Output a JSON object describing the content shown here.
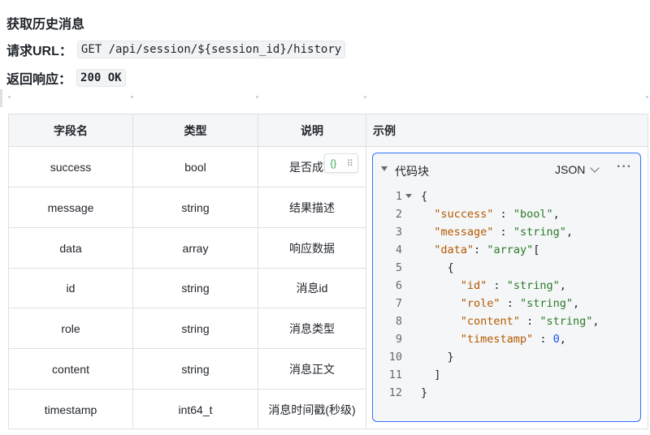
{
  "title": "获取历史消息",
  "request": {
    "label": "请求URL：",
    "value": "GET /api/session/${session_id}/history"
  },
  "response": {
    "label": "返回响应：",
    "value": "200 OK"
  },
  "table": {
    "headers": [
      "字段名",
      "类型",
      "说明",
      "示例"
    ],
    "rows": [
      {
        "field": "success",
        "type": "bool",
        "desc": "是否成功"
      },
      {
        "field": "message",
        "type": "string",
        "desc": "结果描述"
      },
      {
        "field": "data",
        "type": "array",
        "desc": "响应数据"
      },
      {
        "field": "id",
        "type": "string",
        "desc": "消息id"
      },
      {
        "field": "role",
        "type": "string",
        "desc": "消息类型"
      },
      {
        "field": "content",
        "type": "string",
        "desc": "消息正文"
      },
      {
        "field": "timestamp",
        "type": "int64_t",
        "desc": "消息时间戳(秒级)"
      }
    ]
  },
  "float_tool": {
    "icon": "{}",
    "grip": "⠿"
  },
  "codeblock": {
    "title": "代码块",
    "language": "JSON",
    "more": "···",
    "lines": [
      {
        "n": "1",
        "fold": true,
        "indent": "",
        "parts": [
          [
            "p",
            "{"
          ]
        ]
      },
      {
        "n": "2",
        "fold": false,
        "indent": "  ",
        "parts": [
          [
            "k",
            "\"success\""
          ],
          [
            "p",
            " : "
          ],
          [
            "s",
            "\"bool\""
          ],
          [
            "p",
            ","
          ]
        ]
      },
      {
        "n": "3",
        "fold": false,
        "indent": "  ",
        "parts": [
          [
            "k",
            "\"message\""
          ],
          [
            "p",
            " : "
          ],
          [
            "s",
            "\"string\""
          ],
          [
            "p",
            ","
          ]
        ]
      },
      {
        "n": "4",
        "fold": false,
        "indent": "  ",
        "parts": [
          [
            "k",
            "\"data\""
          ],
          [
            "p",
            ": "
          ],
          [
            "s",
            "\"array\""
          ],
          [
            "p",
            "["
          ]
        ]
      },
      {
        "n": "5",
        "fold": false,
        "indent": "    ",
        "parts": [
          [
            "p",
            "{"
          ]
        ]
      },
      {
        "n": "6",
        "fold": false,
        "indent": "      ",
        "parts": [
          [
            "k",
            "\"id\""
          ],
          [
            "p",
            " : "
          ],
          [
            "s",
            "\"string\""
          ],
          [
            "p",
            ","
          ]
        ]
      },
      {
        "n": "7",
        "fold": false,
        "indent": "      ",
        "parts": [
          [
            "k",
            "\"role\""
          ],
          [
            "p",
            " : "
          ],
          [
            "s",
            "\"string\""
          ],
          [
            "p",
            ","
          ]
        ]
      },
      {
        "n": "8",
        "fold": false,
        "indent": "      ",
        "parts": [
          [
            "k",
            "\"content\""
          ],
          [
            "p",
            " : "
          ],
          [
            "s",
            "\"string\""
          ],
          [
            "p",
            ","
          ]
        ]
      },
      {
        "n": "9",
        "fold": false,
        "indent": "      ",
        "parts": [
          [
            "k",
            "\"timestamp\""
          ],
          [
            "p",
            " : "
          ],
          [
            "n",
            "0"
          ],
          [
            "p",
            ","
          ]
        ]
      },
      {
        "n": "10",
        "fold": false,
        "indent": "    ",
        "parts": [
          [
            "p",
            "}"
          ]
        ]
      },
      {
        "n": "11",
        "fold": false,
        "indent": "  ",
        "parts": [
          [
            "p",
            "]"
          ]
        ]
      },
      {
        "n": "12",
        "fold": false,
        "indent": "",
        "parts": [
          [
            "p",
            "}"
          ]
        ]
      }
    ]
  }
}
